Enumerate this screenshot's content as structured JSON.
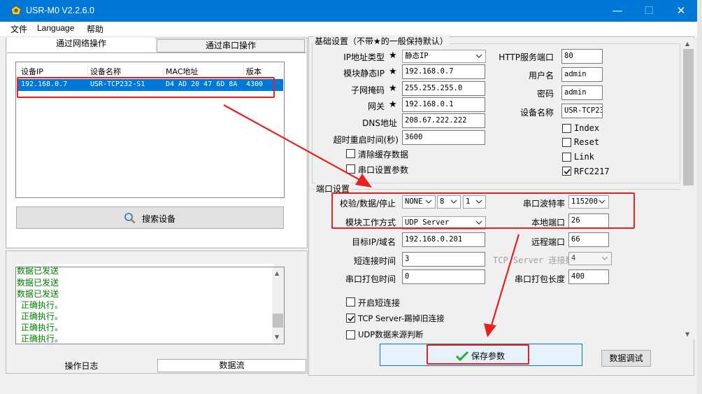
{
  "window": {
    "title": "USR-M0 V2.2.6.0",
    "controls": {
      "minimize": "—",
      "maximize": "☐",
      "close": "✕"
    }
  },
  "menu": [
    "文件",
    "Language",
    "帮助"
  ],
  "left_tabs": {
    "network": "通过网络操作",
    "serial": "通过串口操作"
  },
  "device_list": {
    "headers": [
      "设备IP",
      "设备名称",
      "MAC地址",
      "版本"
    ],
    "rows": [
      {
        "ip": "192.168.0.7",
        "name": "USR-TCP232-S1",
        "mac": "D4 AD 20 47 6D 8A",
        "version": "4300"
      }
    ]
  },
  "search_button": "搜索设备",
  "log": {
    "lines": [
      "数据已发送",
      "数据已发送",
      "数据已发送",
      " 正确执行。",
      " 正确执行。",
      " 正确执行。",
      " 正确执行。"
    ]
  },
  "bottom_tabs": {
    "log": "操作日志",
    "stream": "数据流"
  },
  "basic": {
    "legend": "基础设置（不带★的一般保持默认）",
    "ip_type_label": "IP地址类型",
    "ip_type_value": "静态IP",
    "static_ip_label": "模块静态IP",
    "static_ip_value": "192.168.0.7",
    "subnet_label": "子网掩码",
    "subnet_value": "255.255.255.0",
    "gateway_label": "网关",
    "gateway_value": "192.168.0.1",
    "dns_label": "DNS地址",
    "dns_value": "208.67.222.222",
    "timeout_label": "超时重启时间(秒)",
    "timeout_value": "3600",
    "clear_cache_label": "清除缓存数据",
    "serial_params_label": "串口设置参数",
    "star": "★",
    "http_port_label": "HTTP服务端口",
    "http_port_value": "80",
    "username_label": "用户名",
    "username_value": "admin",
    "password_label": "密码",
    "password_value": "admin",
    "device_name_label": "设备名称",
    "device_name_value": "USR-TCP23",
    "index_label": "Index",
    "reset_label": "Reset",
    "link_label": "Link",
    "rfc_label": "RFC2217"
  },
  "port": {
    "legend": "端口设置",
    "parity_label": "校验/数据/停止",
    "parity_value": "NONE",
    "data_bits": "8",
    "stop_bits": "1",
    "baud_label": "串口波特率",
    "baud_value": "115200",
    "mode_label": "模块工作方式",
    "mode_value": "UDP Server",
    "local_port_label": "本地端口",
    "local_port_value": "26",
    "target_label": "目标IP/域名",
    "target_value": "192.168.0.201",
    "remote_port_label": "远程端口",
    "remote_port_value": "66",
    "short_time_label": "短连接时间",
    "short_time_value": "3",
    "tcp_conn_label": "TCP Server 连接数",
    "tcp_conn_value": "4",
    "packet_time_label": "串口打包时间",
    "packet_time_value": "0",
    "packet_len_label": "串口打包长度",
    "packet_len_value": "400",
    "short_conn_label": "开启短连接",
    "kick_label": "TCP Server-踢掉旧连接",
    "udp_check_label": "UDP数据来源判断"
  },
  "save_button": "保存参数",
  "debug_button": "数据调试",
  "colors": {
    "titlebar": "#0078d7",
    "selection": "#0078d7",
    "annotation": "#e8201e",
    "log_text": "#008000"
  }
}
